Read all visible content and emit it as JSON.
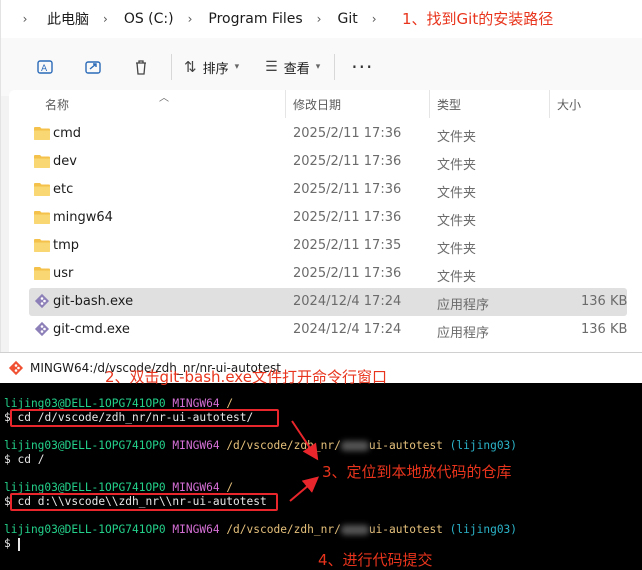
{
  "address_bar": {
    "crumbs": [
      "此电脑",
      "OS (C:)",
      "Program Files",
      "Git"
    ],
    "note": "1、找到Git的安装路径"
  },
  "toolbar": {
    "sort_label": "排序",
    "view_label": "查看",
    "more_label": "···"
  },
  "columns": {
    "name": "名称",
    "modified": "修改日期",
    "type": "类型",
    "size": "大小"
  },
  "files": [
    {
      "name": "cmd",
      "modified": "2025/2/11 17:36",
      "type": "文件夹",
      "size": "",
      "kind": "folder"
    },
    {
      "name": "dev",
      "modified": "2025/2/11 17:36",
      "type": "文件夹",
      "size": "",
      "kind": "folder"
    },
    {
      "name": "etc",
      "modified": "2025/2/11 17:36",
      "type": "文件夹",
      "size": "",
      "kind": "folder"
    },
    {
      "name": "mingw64",
      "modified": "2025/2/11 17:36",
      "type": "文件夹",
      "size": "",
      "kind": "folder"
    },
    {
      "name": "tmp",
      "modified": "2025/2/11 17:35",
      "type": "文件夹",
      "size": "",
      "kind": "folder"
    },
    {
      "name": "usr",
      "modified": "2025/2/11 17:36",
      "type": "文件夹",
      "size": "",
      "kind": "folder"
    },
    {
      "name": "git-bash.exe",
      "modified": "2024/12/4 17:24",
      "type": "应用程序",
      "size": "136 KB",
      "kind": "app"
    },
    {
      "name": "git-cmd.exe",
      "modified": "2024/12/4 17:24",
      "type": "应用程序",
      "size": "136 KB",
      "kind": "app"
    }
  ],
  "file_note": "2、双击git-bash.exe文件打开命令行窗口",
  "terminal": {
    "title": "MINGW64:/d/vscode/zdh_nr/nr-ui-autotest",
    "user": "lijing03@DELL-1OPG741OP0",
    "env": "MINGW64",
    "path_root": "/",
    "path_repo_prefix": "/d/vscode/zdh_nr/",
    "path_repo_suffix": "ui-autotest",
    "branch": "(lijing03)",
    "prompt": "$",
    "cmd1": "cd /d/vscode/zdh_nr/nr-ui-autotest/",
    "cmd2": "cd /",
    "cmd3": "cd d:\\\\vscode\\\\zdh_nr\\\\nr-ui-autotest",
    "note3": "3、定位到本地放代码的仓库",
    "note4": "4、进行代码提交"
  },
  "colors": {
    "annotation": "#e8341c",
    "highlight_box": "#e8262b",
    "prompt_user": "#23d18b",
    "prompt_env": "#d670d6",
    "prompt_path": "#e5c07b",
    "branch": "#2bb3c8"
  }
}
